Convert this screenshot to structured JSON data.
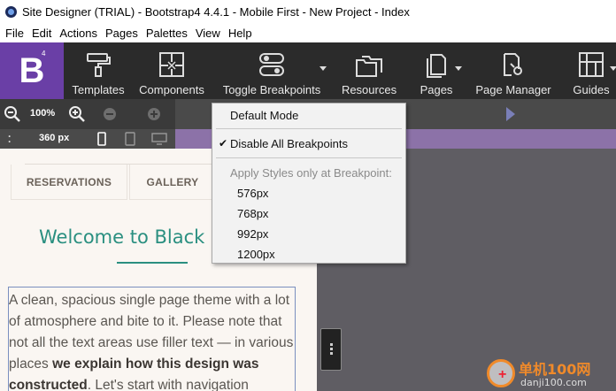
{
  "window": {
    "title": "Site Designer (TRIAL) - Bootstrap4 4.4.1 - Mobile First - New Project - Index"
  },
  "menu": [
    "File",
    "Edit",
    "Actions",
    "Pages",
    "Palettes",
    "View",
    "Help"
  ],
  "logo": {
    "letter": "B",
    "superscript": "4",
    "color": "#6a3fa6"
  },
  "toolbar": {
    "templates": "Templates",
    "components": "Components",
    "toggle_breakpoints": "Toggle Breakpoints",
    "resources": "Resources",
    "pages": "Pages",
    "page_manager": "Page Manager",
    "guides": "Guides"
  },
  "zoom": {
    "level": "100%"
  },
  "breakpoint_bar": {
    "width": "360 px"
  },
  "canvas": {
    "nav": [
      "RESERVATIONS",
      "GALLERY"
    ],
    "welcome": "Welcome to Black B",
    "paragraph": {
      "text1": "A clean, spacious single page theme with a lot of atmosphere and bite to it. Please note that not all the text areas use filler text — in various places ",
      "bold1": "we explain how this design was constructed",
      "text2": ". Let's start with navigation"
    },
    "accent_color": "#2a8f80"
  },
  "dropdown": {
    "default_mode": "Default Mode",
    "disable_all": "Disable All Breakpoints",
    "disable_all_checked": true,
    "apply_header": "Apply Styles only at Breakpoint:",
    "breakpoints": [
      "576px",
      "768px",
      "992px",
      "1200px"
    ]
  },
  "watermark": {
    "line1": "单机100网",
    "line2": "danji100.com"
  }
}
